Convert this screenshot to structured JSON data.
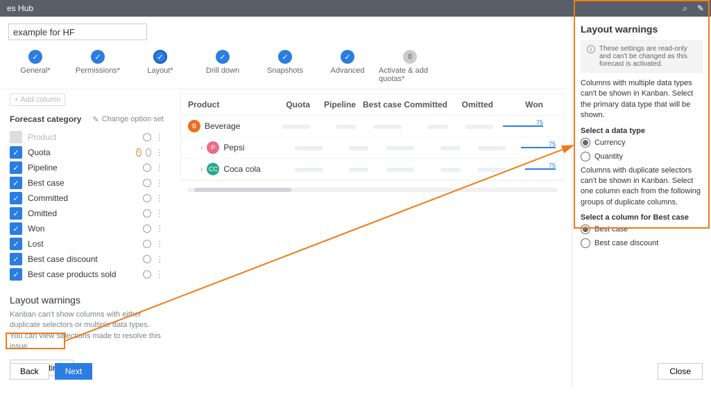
{
  "topbar": {
    "title": "es Hub"
  },
  "title_input_value": "example for HF",
  "steps": [
    {
      "label": "General*",
      "state": "done"
    },
    {
      "label": "Permissions*",
      "state": "done"
    },
    {
      "label": "Layout*",
      "state": "current"
    },
    {
      "label": "Drill down",
      "state": "done"
    },
    {
      "label": "Snapshots",
      "state": "done"
    },
    {
      "label": "Advanced",
      "state": "done"
    },
    {
      "label": "Activate & add quotas*",
      "state": "todo",
      "num": "8"
    }
  ],
  "forecast": {
    "add_column": "+ Add column",
    "header": "Forecast category",
    "change_opt": "Change option set",
    "items": [
      {
        "label": "Product",
        "checked": false,
        "disabled": true,
        "info": false
      },
      {
        "label": "Quota",
        "checked": true,
        "info": true
      },
      {
        "label": "Pipeline",
        "checked": true,
        "info": false
      },
      {
        "label": "Best case",
        "checked": true,
        "info": false
      },
      {
        "label": "Committed",
        "checked": true,
        "info": false
      },
      {
        "label": "Omitted",
        "checked": true,
        "info": false
      },
      {
        "label": "Won",
        "checked": true,
        "info": false
      },
      {
        "label": "Lost",
        "checked": true,
        "info": false
      },
      {
        "label": "Best case discount",
        "checked": true,
        "info": false
      },
      {
        "label": "Best case products sold",
        "checked": true,
        "info": false
      }
    ]
  },
  "layout_warnings": {
    "heading": "Layout warnings",
    "text": "Kanban can't show columns with either duplicate selectors or multiple data types. You can view selections made to resolve this issue.",
    "btn": "View settings"
  },
  "preview": {
    "cols": [
      "Product",
      "Quota",
      "Pipeline",
      "Best case",
      "Committed",
      "Omitted",
      "Won"
    ],
    "rows": [
      {
        "name": "Beverage",
        "av": "B",
        "cls": "av-b",
        "child": false,
        "won": 75,
        "wonW": 58
      },
      {
        "name": "Pepsi",
        "av": "P",
        "cls": "av-p",
        "child": true,
        "won": 75,
        "wonW": 50
      },
      {
        "name": "Coca cola",
        "av": "CC",
        "cls": "av-c",
        "child": true,
        "won": 75,
        "wonW": 44
      }
    ]
  },
  "nav": {
    "back": "Back",
    "next": "Next"
  },
  "panel": {
    "title": "Layout warnings",
    "readonly": "These settings are read-only and can't be changed as this forecast is activated.",
    "desc1": "Columns with multiple data types can't be shown in Kanban. Select the primary data type that will be shown.",
    "sect1": "Select a data type",
    "opt_currency": "Currency",
    "opt_quantity": "Quantity",
    "desc2": "Columns with duplicate selectors can't be shown in Kanban. Select one column each from the following groups of duplicate columns.",
    "sect2": "Select a column for Best case",
    "opt_bc": "Best case",
    "opt_bcd": "Best case discount",
    "close": "Close"
  }
}
